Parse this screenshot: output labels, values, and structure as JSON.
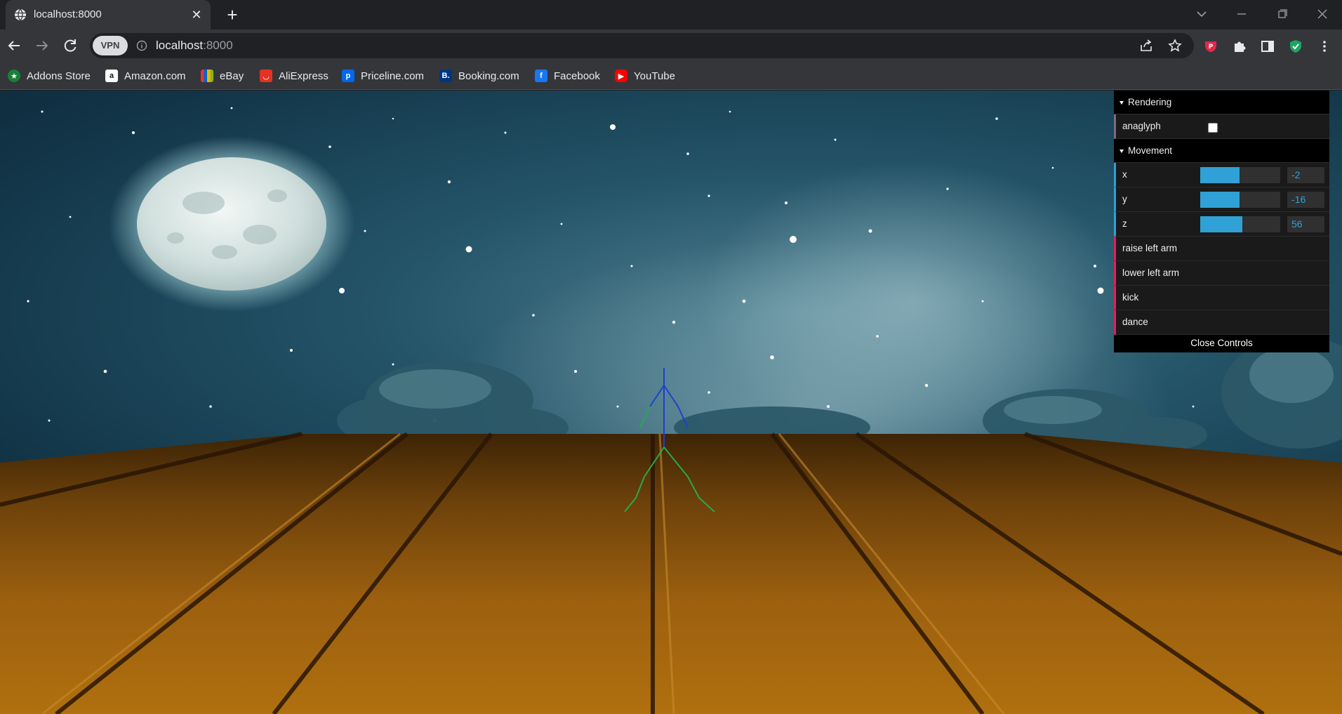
{
  "browser": {
    "tab": {
      "title": "localhost:8000"
    },
    "address": {
      "vpn_label": "VPN",
      "host": "localhost",
      "port": ":8000"
    },
    "bookmarks": [
      {
        "label": "Addons Store",
        "icon": "addons-store-icon",
        "color": "#188038"
      },
      {
        "label": "Amazon.com",
        "icon": "amazon-icon",
        "color": "#ffffff"
      },
      {
        "label": "eBay",
        "icon": "ebay-icon",
        "color": "#e53238"
      },
      {
        "label": "AliExpress",
        "icon": "aliexpress-icon",
        "color": "#e43225"
      },
      {
        "label": "Priceline.com",
        "icon": "priceline-icon",
        "color": "#0068ef"
      },
      {
        "label": "Booking.com",
        "icon": "booking-icon",
        "color": "#003580"
      },
      {
        "label": "Facebook",
        "icon": "facebook-icon",
        "color": "#1877f2"
      },
      {
        "label": "YouTube",
        "icon": "youtube-icon",
        "color": "#ff0000"
      }
    ]
  },
  "gui": {
    "rendering": {
      "title": "Rendering",
      "anaglyph": {
        "label": "anaglyph",
        "checked": false
      }
    },
    "movement": {
      "title": "Movement",
      "x": {
        "label": "x",
        "value": "-2",
        "fill": 0.49
      },
      "y": {
        "label": "y",
        "value": "-16",
        "fill": 0.49
      },
      "z": {
        "label": "z",
        "value": "56",
        "fill": 0.53
      },
      "actions": [
        {
          "label": "raise left arm"
        },
        {
          "label": "lower left arm"
        },
        {
          "label": "kick"
        },
        {
          "label": "dance"
        }
      ]
    },
    "close_label": "Close Controls"
  },
  "colors": {
    "accent_number": "#2fa1d6",
    "bool_border": "#806787",
    "function_border": "#e61d5f",
    "floor": "#a1650f",
    "sky": "#14384a"
  }
}
